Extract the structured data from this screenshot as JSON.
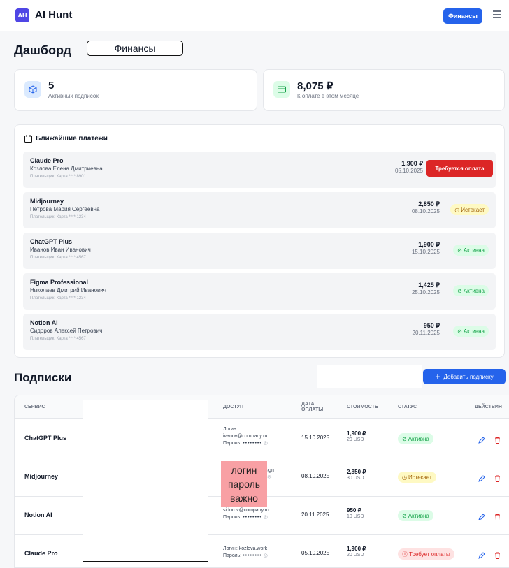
{
  "header": {
    "logo": "AH",
    "brand": "AI Hunt",
    "finance_button": "Финансы",
    "menu_icon": "menu-icon"
  },
  "dashboard": {
    "title": "Дашборд",
    "note": "Финансы"
  },
  "stats": [
    {
      "value": "5",
      "label": "Активных подписок",
      "icon": "cube-icon",
      "color": "#dbeafe"
    },
    {
      "value": "8,075 ₽",
      "label": "К оплате в этом месяце",
      "icon": "card-icon",
      "color": "#dcfce7"
    }
  ],
  "payments": {
    "title": "Ближайшие платежи",
    "items": [
      {
        "name": "Claude Pro",
        "person": "Козлова Елена Дмитриевна",
        "payer": "Плательщик: Карта **** 8901",
        "amount": "1,900 ₽",
        "date": "05.10.2025",
        "status": "Требуется оплата",
        "status_type": "button"
      },
      {
        "name": "Midjourney",
        "person": "Петрова Мария Сергеевна",
        "payer": "Плательщик: Карта **** 1234",
        "amount": "2,850 ₽",
        "date": "08.10.2025",
        "status": "Истекает",
        "status_type": "warn"
      },
      {
        "name": "ChatGPT Plus",
        "person": "Иванов Иван Иванович",
        "payer": "Плательщик: Карта **** 4567",
        "amount": "1,900 ₽",
        "date": "15.10.2025",
        "status": "Активна",
        "status_type": "ok"
      },
      {
        "name": "Figma Professional",
        "person": "Николаев Дмитрий Иванович",
        "payer": "Плательщик: Карта **** 1234",
        "amount": "1,425 ₽",
        "date": "25.10.2025",
        "status": "Активна",
        "status_type": "ok"
      },
      {
        "name": "Notion AI",
        "person": "Сидоров Алексей Петрович",
        "payer": "Плательщик: Карта **** 4567",
        "amount": "950 ₽",
        "date": "20.11.2025",
        "status": "Активна",
        "status_type": "ok"
      }
    ]
  },
  "subscriptions": {
    "title": "Подписки",
    "add_button": "Добавить подписку",
    "columns": {
      "service": "СЕРВИС",
      "access": "ДОСТУП",
      "date_l1": "ДАТА",
      "date_l2": "ОПЛАТЫ",
      "cost": "СТОИМОСТЬ",
      "status": "СТАТУС",
      "actions": "ДЕЙСТВИЯ"
    },
    "rows": [
      {
        "service": "ChatGPT Plus",
        "login_label": "Логин:",
        "login": "ivanov@company.ru",
        "password_label": "Пароль:",
        "password": "••••••••",
        "date": "15.10.2025",
        "cost": "1,900 ₽",
        "cost_usd": "20 USD",
        "status": "Активна",
        "status_type": "ok"
      },
      {
        "service": "Midjourney",
        "login_label": "",
        "login": "sign",
        "password_label": "",
        "password": "•",
        "date": "08.10.2025",
        "cost": "2,850 ₽",
        "cost_usd": "30 USD",
        "status": "Истекает",
        "status_type": "warn"
      },
      {
        "service": "Notion AI",
        "login_label": "",
        "login": "sidorov@company.ru",
        "password_label": "Пароль:",
        "password": "••••••••",
        "date": "20.11.2025",
        "cost": "950 ₽",
        "cost_usd": "10 USD",
        "status": "Активна",
        "status_type": "ok"
      },
      {
        "service": "Claude Pro",
        "login_label": "Логин:",
        "login": "kozlova.work",
        "password_label": "Пароль:",
        "password": "••••••••",
        "date": "05.10.2025",
        "cost": "1,900 ₽",
        "cost_usd": "20 USD",
        "status": "Требует оплаты",
        "status_type": "err"
      }
    ]
  },
  "sticker": {
    "line1": "логин",
    "line2": "пароль",
    "line3": "важно"
  },
  "colors": {
    "accent": "#2563eb",
    "danger": "#dc2626",
    "ok_bg": "#dcfce7",
    "ok_fg": "#16a34a",
    "warn_bg": "#fef9c3",
    "warn_fg": "#a16207",
    "err_bg": "#fee2e2",
    "err_fg": "#dc2626"
  }
}
